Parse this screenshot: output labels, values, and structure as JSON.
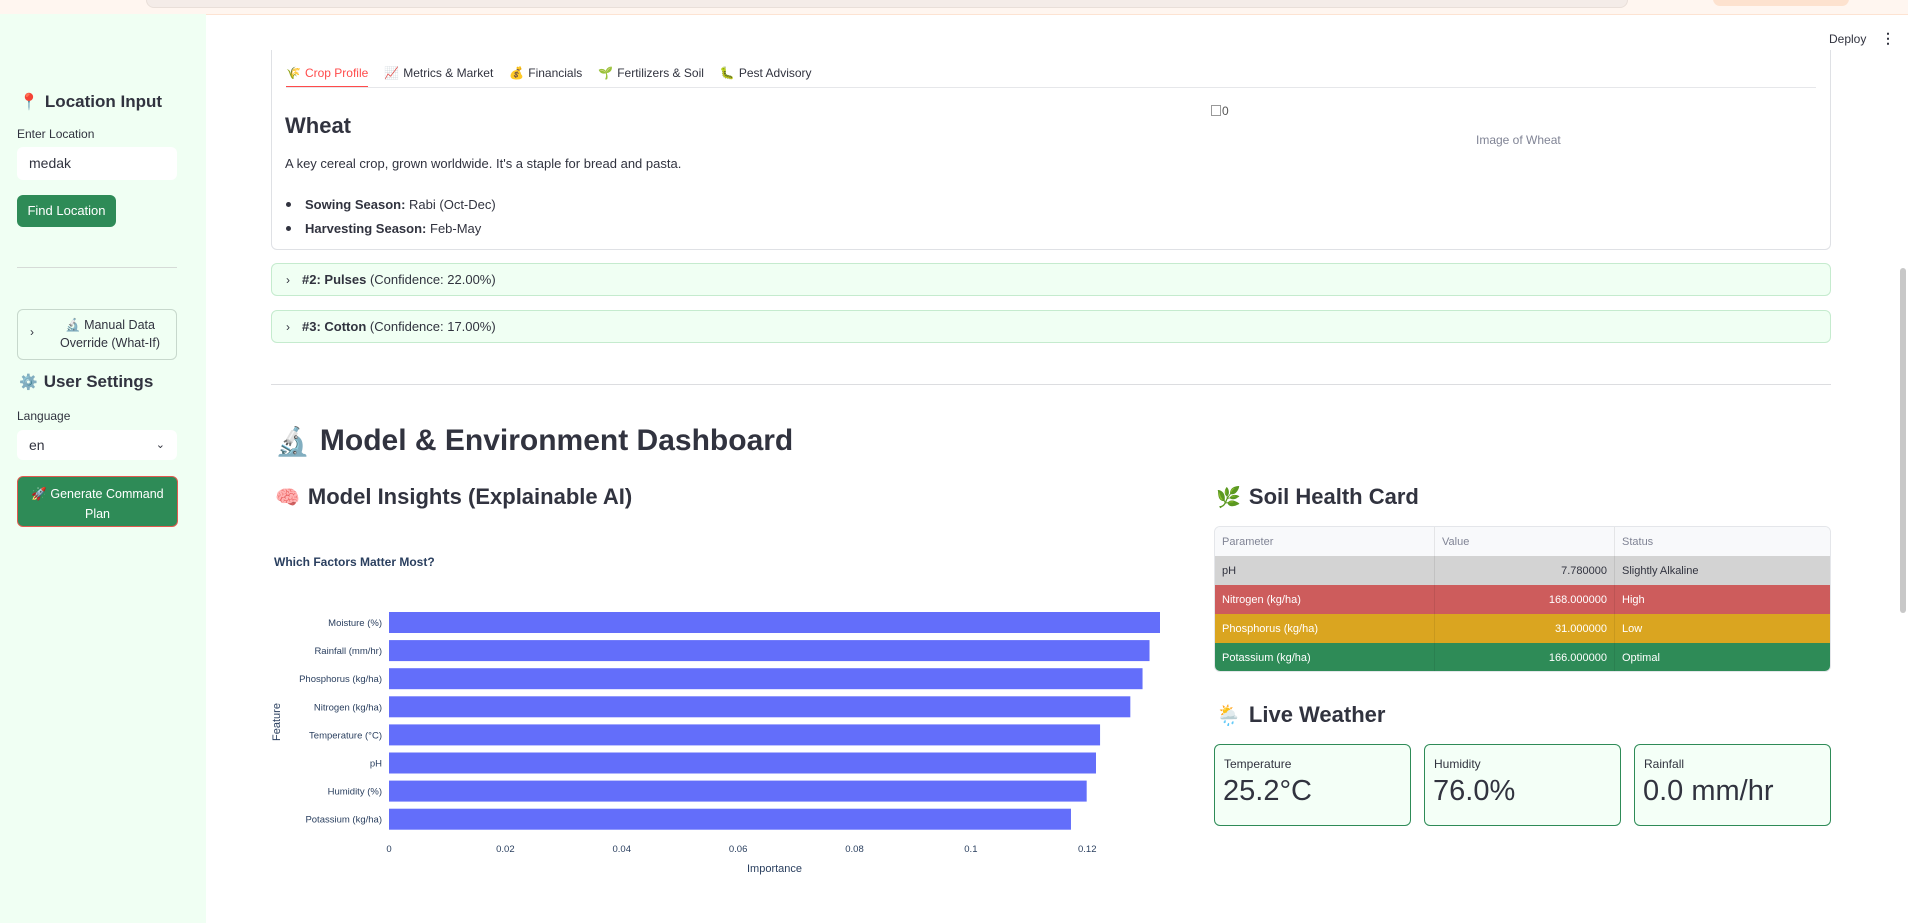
{
  "header": {
    "deploy_label": "Deploy",
    "menu_icon": "kebab-icon"
  },
  "sidebar": {
    "location_heading": "Location Input",
    "location_icon": "pin-icon",
    "location_label": "Enter Location",
    "location_value": "medak",
    "find_button": "Find Location",
    "override_label_line1": "🔬 Manual Data",
    "override_label_line2": "Override (What-If)",
    "settings_heading": "User Settings",
    "settings_icon": "gear-icon",
    "language_label": "Language",
    "language_value": "en",
    "generate_line1": "🚀 Generate Command",
    "generate_line2": "Plan"
  },
  "tabs": [
    {
      "icon": "🌾",
      "label": "Crop Profile"
    },
    {
      "icon": "📈",
      "label": "Metrics & Market"
    },
    {
      "icon": "💰",
      "label": "Financials"
    },
    {
      "icon": "🌱",
      "label": "Fertilizers & Soil"
    },
    {
      "icon": "🐛",
      "label": "Pest Advisory"
    }
  ],
  "crop": {
    "name": "Wheat",
    "description": "A key cereal crop, grown worldwide. It's a staple for bread and pasta.",
    "sowing_label": "Sowing Season:",
    "sowing_value": "Rabi (Oct-Dec)",
    "harvest_label": "Harvesting Season:",
    "harvest_value": "Feb-May",
    "image_alt": "0",
    "image_caption": "Image of Wheat"
  },
  "alternatives": [
    {
      "rank": "#2: Pulses",
      "confidence": "(Confidence: 22.00%)"
    },
    {
      "rank": "#3: Cotton",
      "confidence": "(Confidence: 17.00%)"
    }
  ],
  "dashboard": {
    "title": "Model & Environment Dashboard",
    "insights_title": "Model Insights (Explainable AI)",
    "soil_title": "Soil Health Card",
    "weather_title": "Live Weather"
  },
  "chart_data": {
    "type": "bar",
    "orientation": "horizontal",
    "title": "Which Factors Matter Most?",
    "xlabel": "Importance",
    "ylabel": "Feature",
    "categories": [
      "Moisture (%)",
      "Rainfall (mm/hr)",
      "Phosphorus (kg/ha)",
      "Nitrogen (kg/ha)",
      "Temperature (°C)",
      "pH",
      "Humidity (%)",
      "Potassium (kg/ha)"
    ],
    "values": [
      0.1325,
      0.1307,
      0.1295,
      0.1274,
      0.1222,
      0.1215,
      0.1199,
      0.1172
    ],
    "xlim": [
      0,
      0.1325
    ],
    "xticks": [
      "0",
      "0.02",
      "0.04",
      "0.06",
      "0.08",
      "0.1",
      "0.12"
    ],
    "bar_color": "#636efa"
  },
  "soil": {
    "headers": [
      "Parameter",
      "Value",
      "Status"
    ],
    "rows": [
      {
        "parameter": "pH",
        "value": "7.780000",
        "status": "Slightly Alkaline",
        "color": "#d3d3d3",
        "text_color": "#31333f"
      },
      {
        "parameter": "Nitrogen (kg/ha)",
        "value": "168.000000",
        "status": "High",
        "color": "#cd5c5c",
        "text_color": "#ffffff"
      },
      {
        "parameter": "Phosphorus (kg/ha)",
        "value": "31.000000",
        "status": "Low",
        "color": "#daa520",
        "text_color": "#ffffff"
      },
      {
        "parameter": "Potassium (kg/ha)",
        "value": "166.000000",
        "status": "Optimal",
        "color": "#2e8b57",
        "text_color": "#ffffff"
      }
    ]
  },
  "weather": [
    {
      "label": "Temperature",
      "value": "25.2°C"
    },
    {
      "label": "Humidity",
      "value": "76.0%"
    },
    {
      "label": "Rainfall",
      "value": "0.0 mm/hr"
    }
  ]
}
